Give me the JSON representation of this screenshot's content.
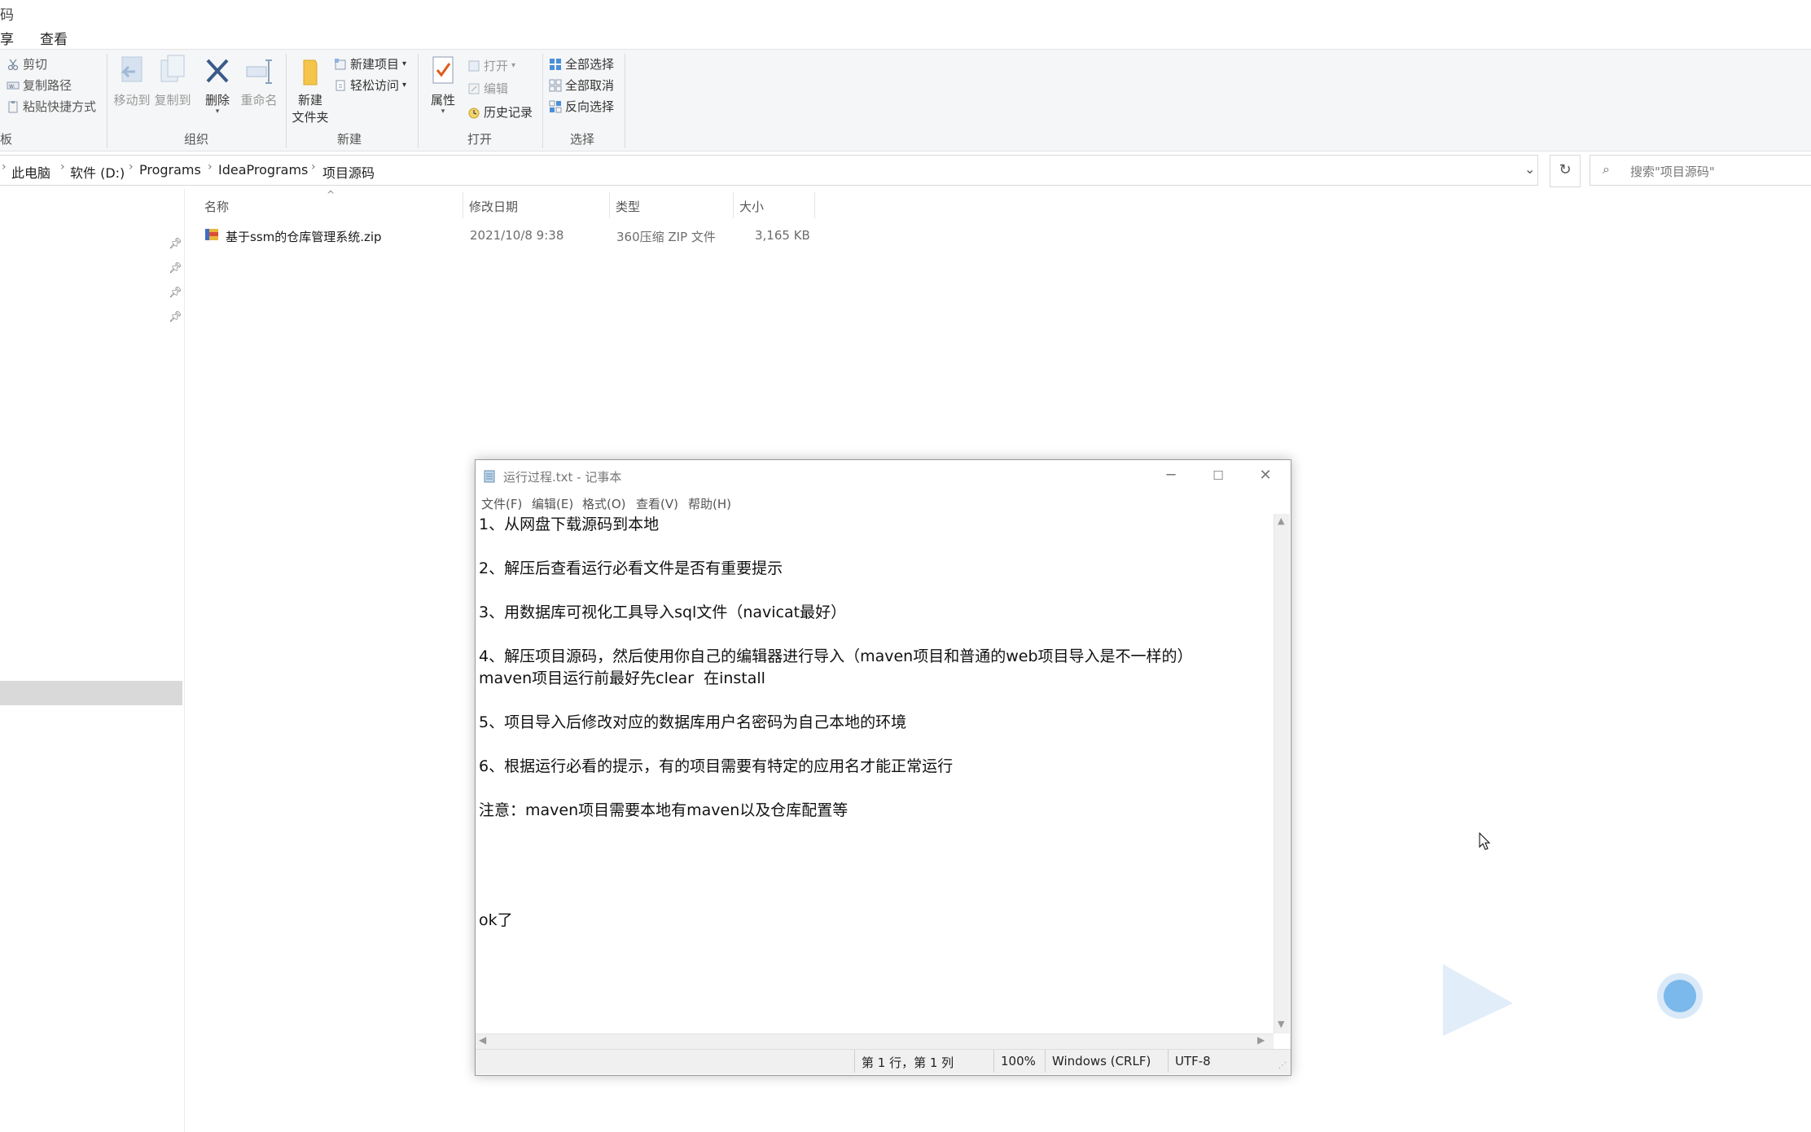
{
  "window": {
    "title_fragment": "码"
  },
  "ribbon_tabs": {
    "share": "享",
    "view": "查看"
  },
  "ribbon": {
    "clipboard": {
      "cut": "剪切",
      "copy_path": "复制路径",
      "paste_shortcut": "粘贴快捷方式"
    },
    "organize": {
      "move_to": "移动到",
      "copy_to": "复制到",
      "delete": "删除",
      "rename": "重命名",
      "group": "组织"
    },
    "new": {
      "new_folder_line1": "新建",
      "new_folder_line2": "文件夹",
      "new_item": "新建项目",
      "easy_access": "轻松访问",
      "group": "新建"
    },
    "open": {
      "properties": "属性",
      "open": "打开",
      "edit": "编辑",
      "history": "历史记录",
      "group": "打开"
    },
    "select": {
      "select_all": "全部选择",
      "select_none": "全部取消",
      "invert": "反向选择",
      "group": "选择"
    }
  },
  "address": {
    "crumbs": [
      "此电脑",
      "软件 (D:)",
      "Programs",
      "IdeaPrograms",
      "项目源码"
    ],
    "search_placeholder": "搜索\"项目源码\""
  },
  "file_list": {
    "columns": [
      "名称",
      "修改日期",
      "类型",
      "大小"
    ],
    "rows": [
      {
        "name": "基于ssm的仓库管理系统.zip",
        "modified": "2021/10/8 9:38",
        "type": "360压缩 ZIP 文件",
        "size": "3,165 KB"
      }
    ]
  },
  "notepad": {
    "title": "运行过程.txt - 记事本",
    "menus": [
      "文件(F)",
      "编辑(E)",
      "格式(O)",
      "查看(V)",
      "帮助(H)"
    ],
    "lines": [
      "1、从网盘下载源码到本地",
      "2、解压后查看运行必看文件是否有重要提示",
      "3、用数据库可视化工具导入sql文件（navicat最好）",
      "4、解压项目源码，然后使用你自己的编辑器进行导入（maven项目和普通的web项目导入是不一样的）",
      "maven项目运行前最好先clear  在install",
      "5、项目导入后修改对应的数据库用户名密码为自己本地的环境",
      "6、根据运行必看的提示，有的项目需要有特定的应用名才能正常运行",
      "注意：maven项目需要本地有maven以及仓库配置等",
      "ok了"
    ],
    "status": {
      "position": "第 1 行，第 1 列",
      "zoom": "100%",
      "line_ending": "Windows (CRLF)",
      "encoding": "UTF-8"
    }
  },
  "colors": {
    "accent": "#0078d7",
    "folder": "#f4c54a",
    "selection": "#d9d9d9"
  }
}
